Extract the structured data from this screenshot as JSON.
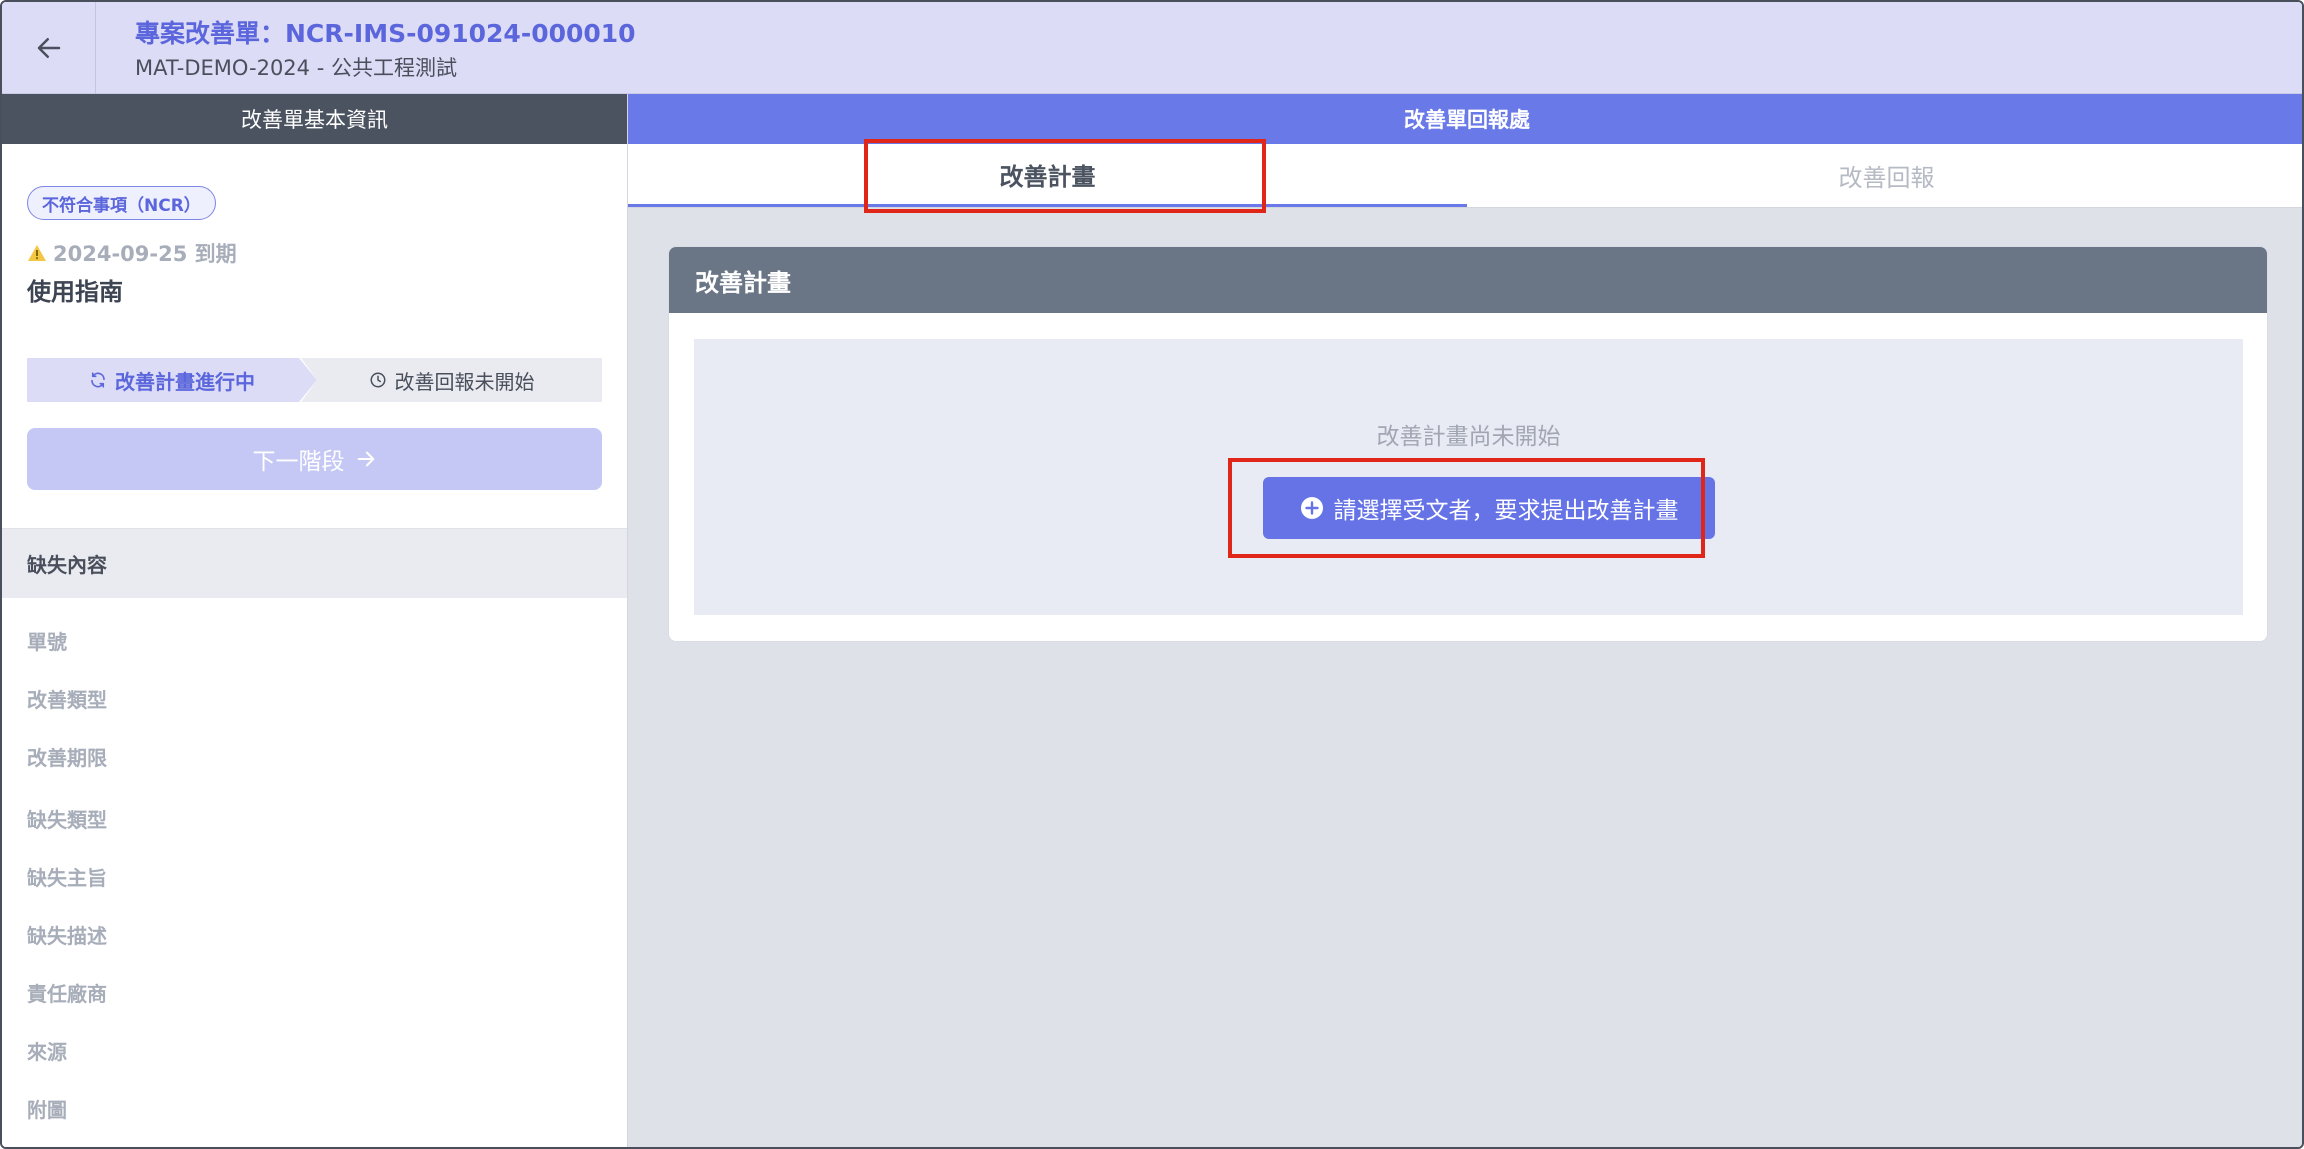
{
  "header": {
    "title": "專案改善單：NCR-IMS-091024-000010",
    "subtitle": "MAT-DEMO-2024 - 公共工程測試",
    "back_icon": "arrow-left-icon"
  },
  "left_panel": {
    "heading": "改善單基本資訊",
    "badge": "不符合事項（NCR）",
    "due_date": "2024-09-25 到期",
    "guide": "使用指南",
    "steps": {
      "active": "改善計畫進行中",
      "pending": "改善回報未開始"
    },
    "next_stage_label": "下一階段",
    "section_title": "缺失內容",
    "fields": [
      "單號",
      "改善類型",
      "改善期限",
      "缺失類型",
      "缺失主旨",
      "缺失描述",
      "責任廠商",
      "來源",
      "附圖"
    ]
  },
  "right_panel": {
    "heading": "改善單回報處",
    "tabs": [
      {
        "label": "改善計畫",
        "active": true
      },
      {
        "label": "改善回報",
        "active": false
      }
    ],
    "card": {
      "title": "改善計畫",
      "empty_text": "改善計畫尚未開始",
      "request_button": "請選擇受文者，要求提出改善計畫"
    }
  },
  "colors": {
    "accent": "#6a79e8",
    "header_bg": "#dcdcf6",
    "highlight": "#e02618"
  }
}
